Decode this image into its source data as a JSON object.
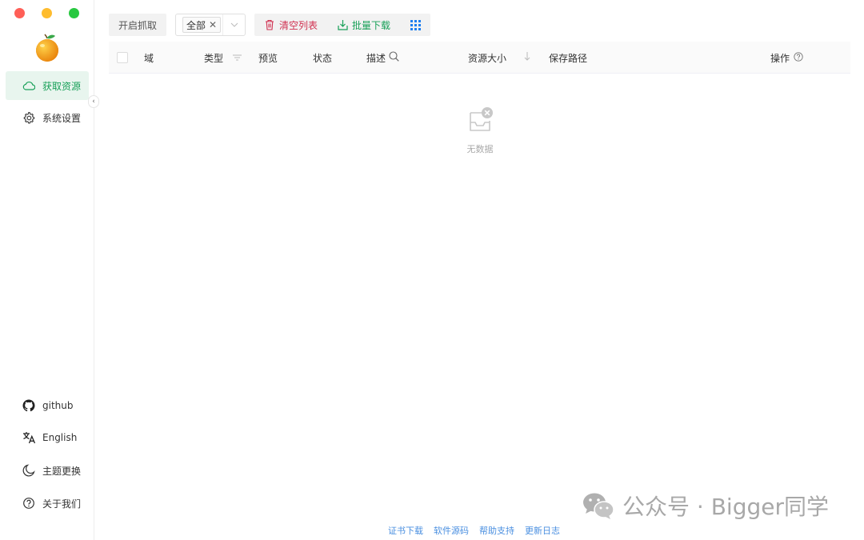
{
  "sidebar": {
    "nav": [
      {
        "label": "获取资源",
        "icon": "cloud-icon",
        "active": true
      },
      {
        "label": "系统设置",
        "icon": "gear-icon",
        "active": false
      }
    ],
    "bottom": [
      {
        "label": "github",
        "icon": "github-icon"
      },
      {
        "label": "English",
        "icon": "translate-icon"
      },
      {
        "label": "主题更换",
        "icon": "moon-icon"
      },
      {
        "label": "关于我们",
        "icon": "help-circle-icon"
      }
    ],
    "collapse_glyph": "‹"
  },
  "toolbar": {
    "start_capture": "开启抓取",
    "filter_tag": "全部",
    "clear_list": "清空列表",
    "batch_download": "批量下载"
  },
  "table": {
    "columns": {
      "domain": "域",
      "type": "类型",
      "preview": "预览",
      "status": "状态",
      "description": "描述",
      "size": "资源大小",
      "save_path": "保存路径",
      "actions": "操作"
    },
    "empty_text": "无数据"
  },
  "footer": {
    "links": [
      "证书下载",
      "软件源码",
      "帮助支持",
      "更新日志"
    ]
  },
  "watermark": {
    "text": "公众号 · Bigger同学"
  },
  "colors": {
    "accent_green": "#18a058",
    "danger_red": "#d03050",
    "link_blue": "#4a8fe0",
    "active_bg": "#e8f5ee"
  }
}
